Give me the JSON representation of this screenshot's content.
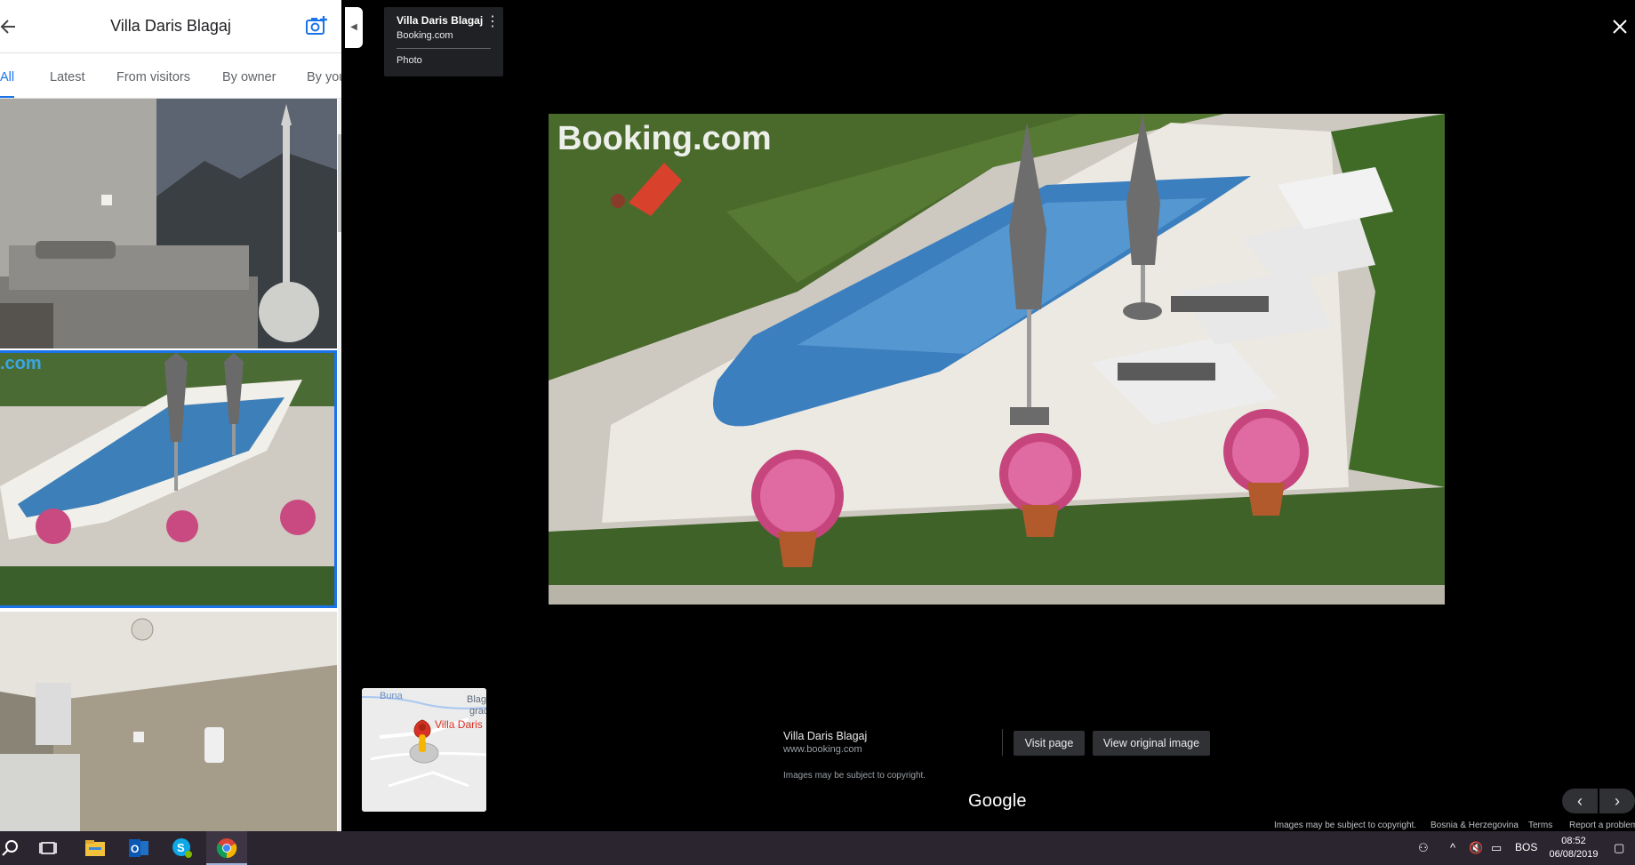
{
  "left_panel": {
    "title": "Villa Daris Blagaj",
    "back_icon": "arrow-left-icon",
    "add_photo_icon": "camera-plus-icon",
    "tabs": [
      {
        "label": "All",
        "active": true
      },
      {
        "label": "Latest",
        "active": false
      },
      {
        "label": "From visitors",
        "active": false
      },
      {
        "label": "By owner",
        "active": false
      },
      {
        "label": "By you",
        "active": false
      }
    ],
    "thumbnails": [
      {
        "subject": "bedroom"
      },
      {
        "subject": "pool",
        "watermark": ".com",
        "selected": true
      },
      {
        "subject": "bathroom"
      }
    ],
    "accent_color": "#1a73e8"
  },
  "info_card": {
    "title": "Villa Daris Blagaj",
    "source": "Booking.com",
    "type": "Photo"
  },
  "viewer": {
    "watermark": "Booking.com",
    "close_icon": "close-icon",
    "map": {
      "river_label": "Buna",
      "town_label_1": "Blag",
      "town_label_2": "grad",
      "place_label": "Villa Daris"
    },
    "bottom": {
      "title": "Villa Daris Blagaj",
      "url": "www.booking.com",
      "copyright_note": "Images may be subject to copyright.",
      "visit_label": "Visit page",
      "view_original_label": "View original image",
      "logo": "Google"
    },
    "nav": {
      "prev": "‹",
      "next": "›"
    },
    "footer": {
      "copyright": "Images may be subject to copyright.",
      "region": "Bosnia & Herzegovina",
      "terms": "Terms",
      "report": "Report a problem"
    }
  },
  "taskbar": {
    "apps": [
      "search-icon",
      "task-view-icon",
      "file-explorer-icon",
      "outlook-icon",
      "skype-icon",
      "chrome-icon"
    ],
    "language": "BOS",
    "time": "08:52",
    "date": "06/08/2019"
  }
}
